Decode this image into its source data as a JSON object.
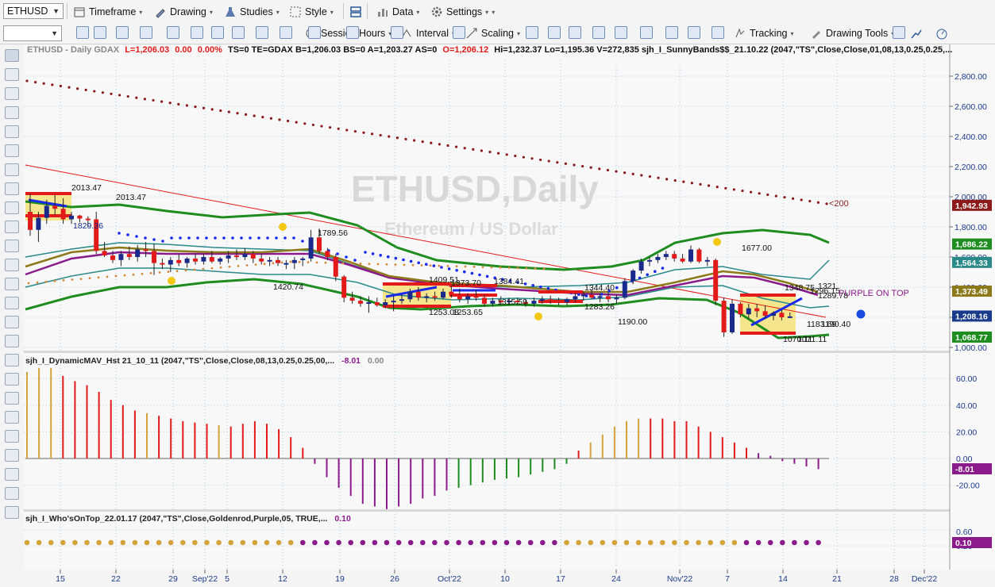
{
  "toolbar1": {
    "symbol": "ETHUSD",
    "timeframe": "Timeframe",
    "drawing": "Drawing",
    "studies": "Studies",
    "style": "Style",
    "data": "Data",
    "settings": "Settings"
  },
  "toolbar2": {
    "session_hours": "Session Hours",
    "interval": "Interval",
    "scaling": "Scaling",
    "tracking": "Tracking",
    "drawing_tools": "Drawing Tools"
  },
  "header": {
    "symbol_line": "ETHUSD - Daily  GDAX",
    "last": "L=1,206.03",
    "change": "0.00",
    "change_pct": "0.00%",
    "rest": "TS=0  TE=GDAX  B=1,206.03  BS=0  A=1,203.27  AS=0",
    "open": "O=1,206.12",
    "tail": "Hi=1,232.37  Lo=1,195.36  V=272,835  sjh_I_SunnyBands$$_21.10.22 (2047,\"TS\",Close,Close,01,08,13,0.25,0.25,..."
  },
  "watermark": {
    "title": "ETHUSD,Daily",
    "subtitle": "Ethereum / US Dollar"
  },
  "annotations": {
    "a1": "2013.47",
    "a2": "2013.47",
    "a3": "1829.36",
    "a4": "1789.56",
    "a5": "1420.74",
    "a6": "1409.51",
    "a7": "1373.70",
    "a8": "1384.41",
    "a9": "1253.08",
    "a10": "1253.65",
    "a11": "1315.59",
    "a12": "1344.40",
    "a13": "1283.26",
    "a14": "1190.00",
    "a15": "1677.00",
    "a16": "1348.75",
    "a17": "1321",
    "a18": "1296.15",
    "a19": "1289.78",
    "a20": "1183.69",
    "a21": "1190.40",
    "a22": "1070.11",
    "a23": "1071.11",
    "purple_on_top": "PURPLE ON TOP",
    "lt200": "<200"
  },
  "price_axis": {
    "ticks": [
      "2,800.00",
      "2,600.00",
      "2,400.00",
      "2,200.00",
      "2,000.00",
      "1,800.00",
      "1,600.00",
      "1,400.00",
      "1,200.00",
      "1,000.00"
    ],
    "tags": [
      {
        "label": "1,942.93",
        "color": "#8b1a1a"
      },
      {
        "label": "1,686.22",
        "color": "#1e8c1e"
      },
      {
        "label": "1,564.33",
        "color": "#2a8a8a"
      },
      {
        "label": "1,373.49",
        "color": "#8c7a1a"
      },
      {
        "label": "1,208.16",
        "color": "#1a3a8c"
      },
      {
        "label": "1,068.77",
        "color": "#1e8c1e"
      }
    ]
  },
  "panel2": {
    "title": "sjh_I_DynamicMAV_Hst 21_10_11 (2047,\"TS\",Close,Close,08,13,0.25,0.25,00,...",
    "value1": "-8.01",
    "value2": "0.00",
    "ticks": [
      "60.00",
      "40.00",
      "20.00",
      "0.00",
      "-20.00"
    ],
    "tag": "-8.01"
  },
  "panel3": {
    "title": "sjh_I_Who'sOnTop_22.01.17 (2047,\"TS\",Close,Goldenrod,Purple,05, TRUE,...",
    "value": "0.10",
    "ticks": [
      "0.60",
      "0.20"
    ],
    "tag": "0.10"
  },
  "time_axis": [
    "15",
    "22",
    "29",
    "Sep'22",
    "5",
    "12",
    "19",
    "26",
    "Oct'22",
    "10",
    "17",
    "24",
    "Nov'22",
    "7",
    "14",
    "21",
    "28",
    "Dec'22"
  ],
  "colors": {
    "up": "#1a2a8c",
    "down": "#e31a1a",
    "band_outer": "#1e8c1e",
    "band_mid": "#2a8a8a",
    "goldenrod": "#d4a43a",
    "purple": "#8b1a8b"
  },
  "chart_data": {
    "type": "candlestick",
    "ylim": [
      1000,
      2900
    ],
    "candles": [
      {
        "o": 1900,
        "h": 2020,
        "l": 1740,
        "c": 1780
      },
      {
        "o": 1780,
        "h": 1900,
        "l": 1700,
        "c": 1860
      },
      {
        "o": 1860,
        "h": 1980,
        "l": 1820,
        "c": 1940
      },
      {
        "o": 1940,
        "h": 2013,
        "l": 1880,
        "c": 1920
      },
      {
        "o": 1920,
        "h": 1990,
        "l": 1820,
        "c": 1850
      },
      {
        "o": 1850,
        "h": 1900,
        "l": 1820,
        "c": 1875
      },
      {
        "o": 1875,
        "h": 1880,
        "l": 1830,
        "c": 1855
      },
      {
        "o": 1855,
        "h": 1870,
        "l": 1800,
        "c": 1850
      },
      {
        "o": 1850,
        "h": 1900,
        "l": 1620,
        "c": 1640
      },
      {
        "o": 1640,
        "h": 1700,
        "l": 1600,
        "c": 1610
      },
      {
        "o": 1610,
        "h": 1640,
        "l": 1560,
        "c": 1580
      },
      {
        "o": 1580,
        "h": 1640,
        "l": 1540,
        "c": 1620
      },
      {
        "o": 1620,
        "h": 1670,
        "l": 1580,
        "c": 1600
      },
      {
        "o": 1600,
        "h": 1680,
        "l": 1570,
        "c": 1650
      },
      {
        "o": 1650,
        "h": 1700,
        "l": 1600,
        "c": 1640
      },
      {
        "o": 1640,
        "h": 1690,
        "l": 1480,
        "c": 1560
      },
      {
        "o": 1560,
        "h": 1590,
        "l": 1520,
        "c": 1550
      },
      {
        "o": 1550,
        "h": 1600,
        "l": 1500,
        "c": 1580
      },
      {
        "o": 1580,
        "h": 1620,
        "l": 1540,
        "c": 1560
      },
      {
        "o": 1560,
        "h": 1600,
        "l": 1530,
        "c": 1590
      },
      {
        "o": 1590,
        "h": 1620,
        "l": 1550,
        "c": 1570
      },
      {
        "o": 1570,
        "h": 1620,
        "l": 1550,
        "c": 1600
      },
      {
        "o": 1600,
        "h": 1640,
        "l": 1560,
        "c": 1570
      },
      {
        "o": 1570,
        "h": 1600,
        "l": 1550,
        "c": 1590
      },
      {
        "o": 1590,
        "h": 1640,
        "l": 1560,
        "c": 1610
      },
      {
        "o": 1610,
        "h": 1650,
        "l": 1580,
        "c": 1600
      },
      {
        "o": 1600,
        "h": 1660,
        "l": 1580,
        "c": 1620
      },
      {
        "o": 1620,
        "h": 1640,
        "l": 1560,
        "c": 1590
      },
      {
        "o": 1590,
        "h": 1620,
        "l": 1550,
        "c": 1570
      },
      {
        "o": 1570,
        "h": 1600,
        "l": 1540,
        "c": 1580
      },
      {
        "o": 1580,
        "h": 1600,
        "l": 1540,
        "c": 1560
      },
      {
        "o": 1560,
        "h": 1580,
        "l": 1520,
        "c": 1560
      },
      {
        "o": 1560,
        "h": 1600,
        "l": 1520,
        "c": 1580
      },
      {
        "o": 1580,
        "h": 1600,
        "l": 1540,
        "c": 1590
      },
      {
        "o": 1590,
        "h": 1780,
        "l": 1570,
        "c": 1730
      },
      {
        "o": 1730,
        "h": 1789,
        "l": 1620,
        "c": 1640
      },
      {
        "o": 1640,
        "h": 1660,
        "l": 1580,
        "c": 1600
      },
      {
        "o": 1600,
        "h": 1620,
        "l": 1440,
        "c": 1470
      },
      {
        "o": 1470,
        "h": 1480,
        "l": 1300,
        "c": 1330
      },
      {
        "o": 1330,
        "h": 1370,
        "l": 1290,
        "c": 1310
      },
      {
        "o": 1310,
        "h": 1340,
        "l": 1270,
        "c": 1290
      },
      {
        "o": 1290,
        "h": 1340,
        "l": 1230,
        "c": 1300
      },
      {
        "o": 1300,
        "h": 1330,
        "l": 1270,
        "c": 1280
      },
      {
        "o": 1280,
        "h": 1320,
        "l": 1260,
        "c": 1300
      },
      {
        "o": 1300,
        "h": 1340,
        "l": 1240,
        "c": 1310
      },
      {
        "o": 1310,
        "h": 1350,
        "l": 1290,
        "c": 1320
      },
      {
        "o": 1320,
        "h": 1390,
        "l": 1300,
        "c": 1370
      },
      {
        "o": 1370,
        "h": 1400,
        "l": 1310,
        "c": 1330
      },
      {
        "o": 1330,
        "h": 1360,
        "l": 1300,
        "c": 1340
      },
      {
        "o": 1340,
        "h": 1370,
        "l": 1310,
        "c": 1330
      },
      {
        "o": 1330,
        "h": 1390,
        "l": 1320,
        "c": 1370
      },
      {
        "o": 1370,
        "h": 1409,
        "l": 1330,
        "c": 1350
      },
      {
        "o": 1350,
        "h": 1390,
        "l": 1300,
        "c": 1320
      },
      {
        "o": 1320,
        "h": 1360,
        "l": 1290,
        "c": 1340
      },
      {
        "o": 1340,
        "h": 1384,
        "l": 1310,
        "c": 1330
      },
      {
        "o": 1330,
        "h": 1350,
        "l": 1270,
        "c": 1290
      },
      {
        "o": 1290,
        "h": 1330,
        "l": 1270,
        "c": 1310
      },
      {
        "o": 1310,
        "h": 1340,
        "l": 1280,
        "c": 1300
      },
      {
        "o": 1300,
        "h": 1330,
        "l": 1280,
        "c": 1310
      },
      {
        "o": 1310,
        "h": 1330,
        "l": 1280,
        "c": 1300
      },
      {
        "o": 1300,
        "h": 1320,
        "l": 1270,
        "c": 1290
      },
      {
        "o": 1290,
        "h": 1330,
        "l": 1270,
        "c": 1310
      },
      {
        "o": 1310,
        "h": 1340,
        "l": 1290,
        "c": 1320
      },
      {
        "o": 1320,
        "h": 1344,
        "l": 1290,
        "c": 1310
      },
      {
        "o": 1310,
        "h": 1330,
        "l": 1280,
        "c": 1300
      },
      {
        "o": 1300,
        "h": 1330,
        "l": 1280,
        "c": 1320
      },
      {
        "o": 1320,
        "h": 1360,
        "l": 1300,
        "c": 1340
      },
      {
        "o": 1340,
        "h": 1370,
        "l": 1310,
        "c": 1350
      },
      {
        "o": 1350,
        "h": 1380,
        "l": 1320,
        "c": 1330
      },
      {
        "o": 1330,
        "h": 1360,
        "l": 1300,
        "c": 1340
      },
      {
        "o": 1340,
        "h": 1370,
        "l": 1300,
        "c": 1320
      },
      {
        "o": 1320,
        "h": 1350,
        "l": 1290,
        "c": 1330
      },
      {
        "o": 1330,
        "h": 1460,
        "l": 1320,
        "c": 1440
      },
      {
        "o": 1440,
        "h": 1520,
        "l": 1420,
        "c": 1510
      },
      {
        "o": 1510,
        "h": 1590,
        "l": 1490,
        "c": 1570
      },
      {
        "o": 1570,
        "h": 1600,
        "l": 1540,
        "c": 1580
      },
      {
        "o": 1580,
        "h": 1620,
        "l": 1560,
        "c": 1600
      },
      {
        "o": 1600,
        "h": 1640,
        "l": 1580,
        "c": 1620
      },
      {
        "o": 1620,
        "h": 1640,
        "l": 1570,
        "c": 1590
      },
      {
        "o": 1590,
        "h": 1620,
        "l": 1560,
        "c": 1570
      },
      {
        "o": 1570,
        "h": 1677,
        "l": 1560,
        "c": 1650
      },
      {
        "o": 1650,
        "h": 1660,
        "l": 1560,
        "c": 1570
      },
      {
        "o": 1570,
        "h": 1600,
        "l": 1540,
        "c": 1580
      },
      {
        "o": 1580,
        "h": 1590,
        "l": 1280,
        "c": 1310
      },
      {
        "o": 1310,
        "h": 1330,
        "l": 1070,
        "c": 1100
      },
      {
        "o": 1100,
        "h": 1320,
        "l": 1090,
        "c": 1290
      },
      {
        "o": 1290,
        "h": 1300,
        "l": 1200,
        "c": 1220
      },
      {
        "o": 1220,
        "h": 1290,
        "l": 1190,
        "c": 1260
      },
      {
        "o": 1260,
        "h": 1290,
        "l": 1200,
        "c": 1240
      },
      {
        "o": 1240,
        "h": 1280,
        "l": 1190,
        "c": 1210
      },
      {
        "o": 1210,
        "h": 1240,
        "l": 1180,
        "c": 1230
      },
      {
        "o": 1230,
        "h": 1250,
        "l": 1180,
        "c": 1200
      },
      {
        "o": 1200,
        "h": 1232,
        "l": 1195,
        "c": 1206
      }
    ],
    "histogram": [
      65,
      68,
      68,
      62,
      58,
      55,
      50,
      44,
      40,
      36,
      34,
      32,
      30,
      28,
      27,
      26,
      25,
      24,
      26,
      28,
      26,
      22,
      16,
      8,
      -4,
      -14,
      -22,
      -28,
      -34,
      -36,
      -38,
      -36,
      -34,
      -30,
      -28,
      -24,
      -22,
      -20,
      -18,
      -16,
      -15,
      -14,
      -12,
      -10,
      -8,
      -4,
      6,
      12,
      18,
      24,
      28,
      30,
      30,
      30,
      28,
      28,
      24,
      20,
      16,
      12,
      8,
      4,
      2,
      -2,
      -4,
      -6,
      -8
    ],
    "wot": [
      "g",
      "g",
      "g",
      "g",
      "g",
      "g",
      "g",
      "g",
      "g",
      "g",
      "g",
      "g",
      "g",
      "g",
      "g",
      "g",
      "g",
      "g",
      "g",
      "g",
      "g",
      "g",
      "g",
      "p",
      "p",
      "p",
      "p",
      "p",
      "p",
      "p",
      "p",
      "p",
      "p",
      "p",
      "p",
      "p",
      "p",
      "p",
      "p",
      "p",
      "p",
      "p",
      "p",
      "p",
      "p",
      "g",
      "g",
      "g",
      "g",
      "g",
      "g",
      "g",
      "g",
      "g",
      "g",
      "g",
      "g",
      "g",
      "g",
      "g",
      "p",
      "p",
      "p",
      "p",
      "p",
      "p",
      "p"
    ]
  }
}
